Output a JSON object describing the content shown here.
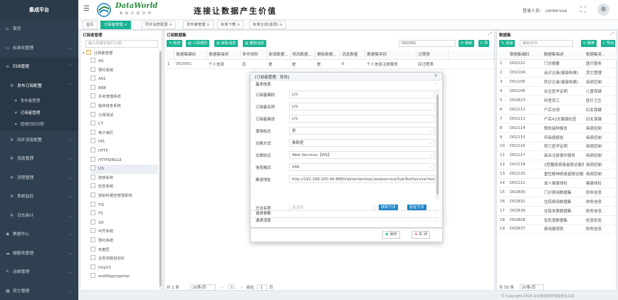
{
  "sidebar": {
    "title": "集成平台",
    "items": [
      {
        "label": "首页",
        "icon": "home-icon"
      },
      {
        "label": "标准化管理",
        "icon": "monitor-icon"
      },
      {
        "label": "ESB管理",
        "icon": "list-icon"
      },
      {
        "label": "发布订阅配置",
        "icon": "gear-icon"
      },
      {
        "label": "同步消息配置",
        "icon": "sync-icon"
      },
      {
        "label": "消息管理",
        "icon": "gear-icon"
      },
      {
        "label": "流程管理",
        "icon": "gear-icon"
      },
      {
        "label": "系统监控",
        "icon": "gear-icon"
      },
      {
        "label": "日志审计",
        "icon": "gear-icon"
      },
      {
        "label": "数据中心",
        "icon": "database-icon"
      },
      {
        "label": "微服务管理",
        "icon": "cloud-icon"
      },
      {
        "label": "运维管理",
        "icon": "tools-icon"
      },
      {
        "label": "其它管理",
        "icon": "more-icon"
      }
    ],
    "sub_items": [
      "发布者管理",
      "订阅者管理",
      "值域代码对照"
    ]
  },
  "header": {
    "logo_text": "DataWorld",
    "logo_sub": "数 据 开 拓 世 界",
    "slogan": "连接让数据产生价值",
    "user": "登录人员： centervue"
  },
  "tabs": [
    "首页",
    "订阅者管理 ×",
    "同步消息配置 ×",
    "发布者管理 ×",
    "标准下载 ×",
    "标准生成(金阳) ×"
  ],
  "tree_panel": {
    "title": "订阅者管理",
    "search_placeholder": "输入关键字进行过滤",
    "root": "订阅者管理",
    "nodes": [
      "AG",
      "预约系统",
      "AR2",
      "BBB",
      "手术管理系统",
      "临床信息系统",
      "订阅测试",
      "CT",
      "电子病历",
      "HIS",
      "HTTP",
      "HTTPSINGLE",
      "LIS",
      "院感系统",
      "检查系统",
      "放射科报告管理系统",
      "TIS",
      "TS",
      "XD",
      "叫号系统",
      "预约系统",
      "布案匠",
      "业务流程自动化",
      "httpV3",
      "wsdlAggregation"
    ]
  },
  "sub_panel": {
    "title": "订阅数据集",
    "buttons": [
      "修改",
      "订阅规则",
      "获取消息",
      "删除消息"
    ],
    "search_value": "D02001",
    "columns": [
      "数据集编码",
      "数据集描述",
      "条件规则",
      "新增数据...",
      "修改数据...",
      "删除数据...",
      "消息数量",
      "数据集类别",
      "过期表"
    ],
    "rows": [
      {
        "num": "1",
        "cells": [
          "D02001",
          "个人信息",
          "否",
          "是",
          "是",
          "是",
          "0",
          "个人信息注册服务",
          "存过程表"
        ]
      }
    ],
    "footer": {
      "total": "共 1 条",
      "page_size": "20条/页",
      "goto": "前往",
      "page": "1",
      "page_unit": "页"
    }
  },
  "ds_panel": {
    "title": "数据集",
    "buttons": [
      "添加"
    ],
    "search_placeholder": "编目名称",
    "right_buttons": [
      "刷新",
      "导出"
    ],
    "columns": [
      "数据集编码",
      "数据集描述",
      "数据集类..."
    ],
    "rows": [
      [
        "1",
        "D02122",
        "门诊摘要",
        "医疗服务"
      ],
      [
        "2",
        "D02104",
        "会诊记录(健康档案)",
        "其它管理"
      ],
      [
        "3",
        "D02105",
        "转诊记录(健康档案)",
        "疾病控制"
      ],
      [
        "4",
        "D02106",
        "出生医学证明",
        "儿童保健"
      ],
      [
        "5",
        "D02823",
        "科室员工",
        "医疗卫生"
      ],
      [
        "6",
        "D02112",
        "产后访视",
        "妇女保健"
      ],
      [
        "7",
        "D02113",
        "产后42天健康检查",
        "妇女保健"
      ],
      [
        "8",
        "D02114",
        "预防接种报告",
        "疾病控制"
      ],
      [
        "9",
        "D02115",
        "传染病报告",
        "疾病控制"
      ],
      [
        "10",
        "D02116",
        "死亡医学证明",
        "疾病控制"
      ],
      [
        "11",
        "D02117",
        "架台注册事件服务",
        "疾病控制"
      ],
      [
        "12",
        "D02118",
        "2型糖尿病患者随访服务",
        "疾病控制"
      ],
      [
        "13",
        "D02120",
        "重性精神病患者随访服务",
        "疾病控制"
      ],
      [
        "14",
        "D02121",
        "成人健康体检",
        "健康体检"
      ],
      [
        "15",
        "D02830",
        "门诊费用数据集",
        "财务信息"
      ],
      [
        "16",
        "D02831",
        "住院费用数据集",
        "财务信息"
      ],
      [
        "17",
        "D02839",
        "住院发票数据集",
        "财务信息"
      ],
      [
        "18",
        "D02828",
        "急危值数据集",
        "检查检验"
      ],
      [
        "19",
        "D02837",
        "费用报销表",
        "财务信息"
      ]
    ],
    "footer": {
      "total": "共 55 条",
      "page_size": "20条/页"
    }
  },
  "modal": {
    "title": "[订阅者管理：修改]",
    "section_basic": "基本信息",
    "fields": [
      {
        "label": "订阅者编码",
        "value": "LIS"
      },
      {
        "label": "订阅者名称",
        "value": "LIS"
      },
      {
        "label": "订阅者描述",
        "value": "LIS"
      },
      {
        "label": "使用标志",
        "value": "是"
      },
      {
        "label": "交换方式",
        "value": "推数据"
      },
      {
        "label": "交换协议",
        "value": "Web Services【WS】"
      },
      {
        "label": "信息格式",
        "value": "XML"
      },
      {
        "label": "推送地址",
        "value": "http://192.168.100.98:8880/dataclient/rpc/webservice/SubTestService?wsdl"
      }
    ],
    "method_label": "方法名称",
    "method_btn1": "获取方法",
    "method_btn2": "验证方法",
    "section_req": "请求参数",
    "section_msg": "请求消息",
    "save": "保存",
    "close": "关 闭"
  },
  "copyright": "© Copyright 2016 长沙德讯软件有限责任公司"
}
